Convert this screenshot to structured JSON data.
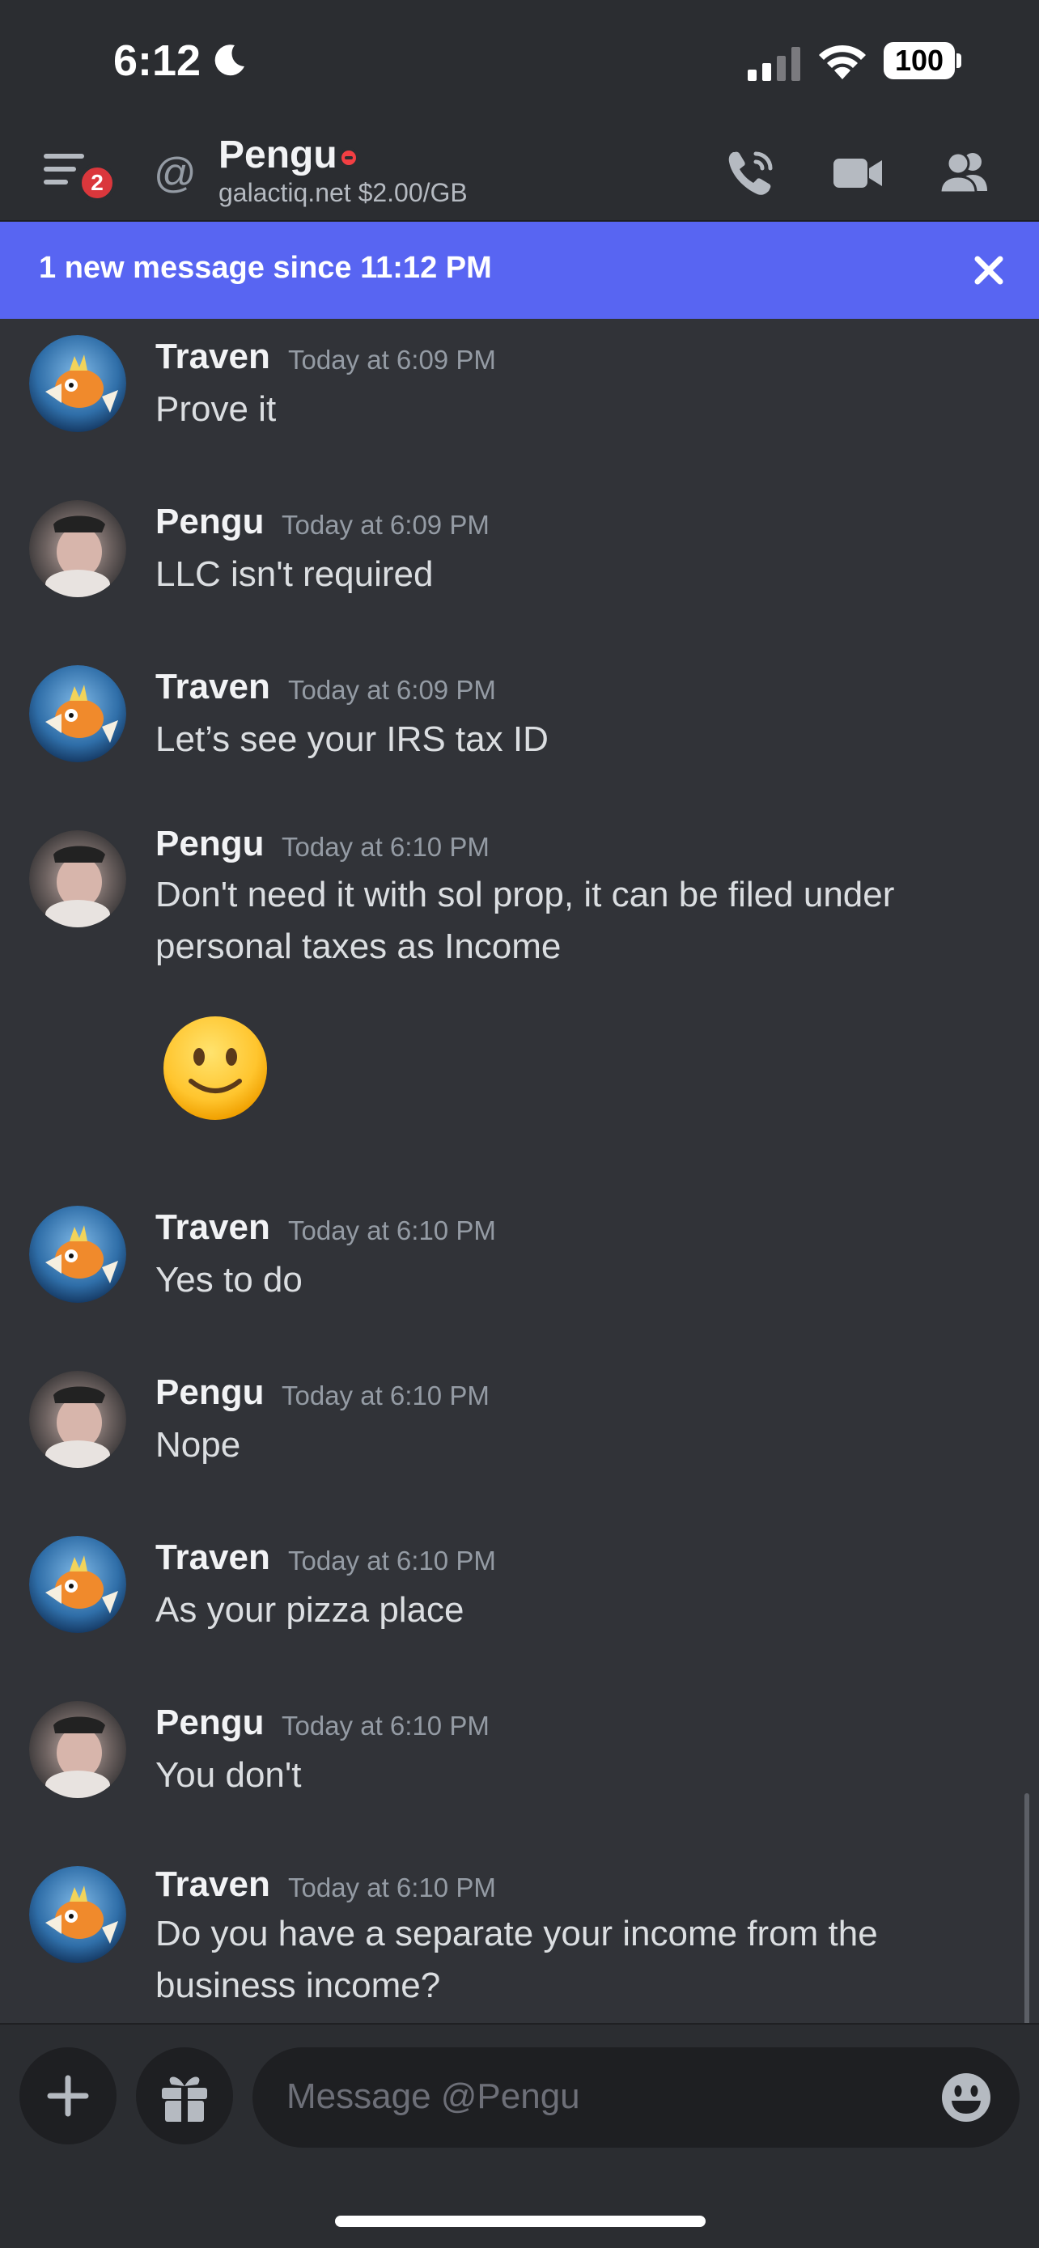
{
  "status_bar": {
    "time": "6:12",
    "battery": "100"
  },
  "header": {
    "notification_count": "2",
    "at_symbol": "@",
    "title": "Pengu",
    "subtitle": "galactiq.net $2.00/GB"
  },
  "banner": {
    "text": "1 new message since 11:12 PM"
  },
  "messages": [
    {
      "author": "Traven",
      "time": "Today at 6:09 PM",
      "text": "Prove it"
    },
    {
      "author": "Pengu",
      "time": "Today at 6:09 PM",
      "text": "LLC isn't required"
    },
    {
      "author": "Traven",
      "time": "Today at 6:09 PM",
      "text": "Let’s see your IRS tax ID"
    },
    {
      "author": "Pengu",
      "time": "Today at 6:10 PM",
      "text_line1": "Don't need it with sol prop, it can be filed under",
      "text_line2": "personal taxes as Income",
      "emoji": "slightly-smiling-face"
    },
    {
      "author": "Traven",
      "time": "Today at 6:10 PM",
      "text": "Yes to do"
    },
    {
      "author": "Pengu",
      "time": "Today at 6:10 PM",
      "text": "Nope"
    },
    {
      "author": "Traven",
      "time": "Today at 6:10 PM",
      "text": "As your pizza place"
    },
    {
      "author": "Pengu",
      "time": "Today at 6:10 PM",
      "text": "You don't"
    },
    {
      "author": "Traven",
      "time": "Today at 6:10 PM",
      "text_line1": "Do you have a separate your income from the",
      "text_line2": "business income?"
    }
  ],
  "input": {
    "placeholder": "Message @Pengu"
  },
  "colors": {
    "background": "#313338",
    "header": "#2b2d31",
    "banner": "#5865f2",
    "badge": "#da373c",
    "dnd": "#f23f43"
  }
}
